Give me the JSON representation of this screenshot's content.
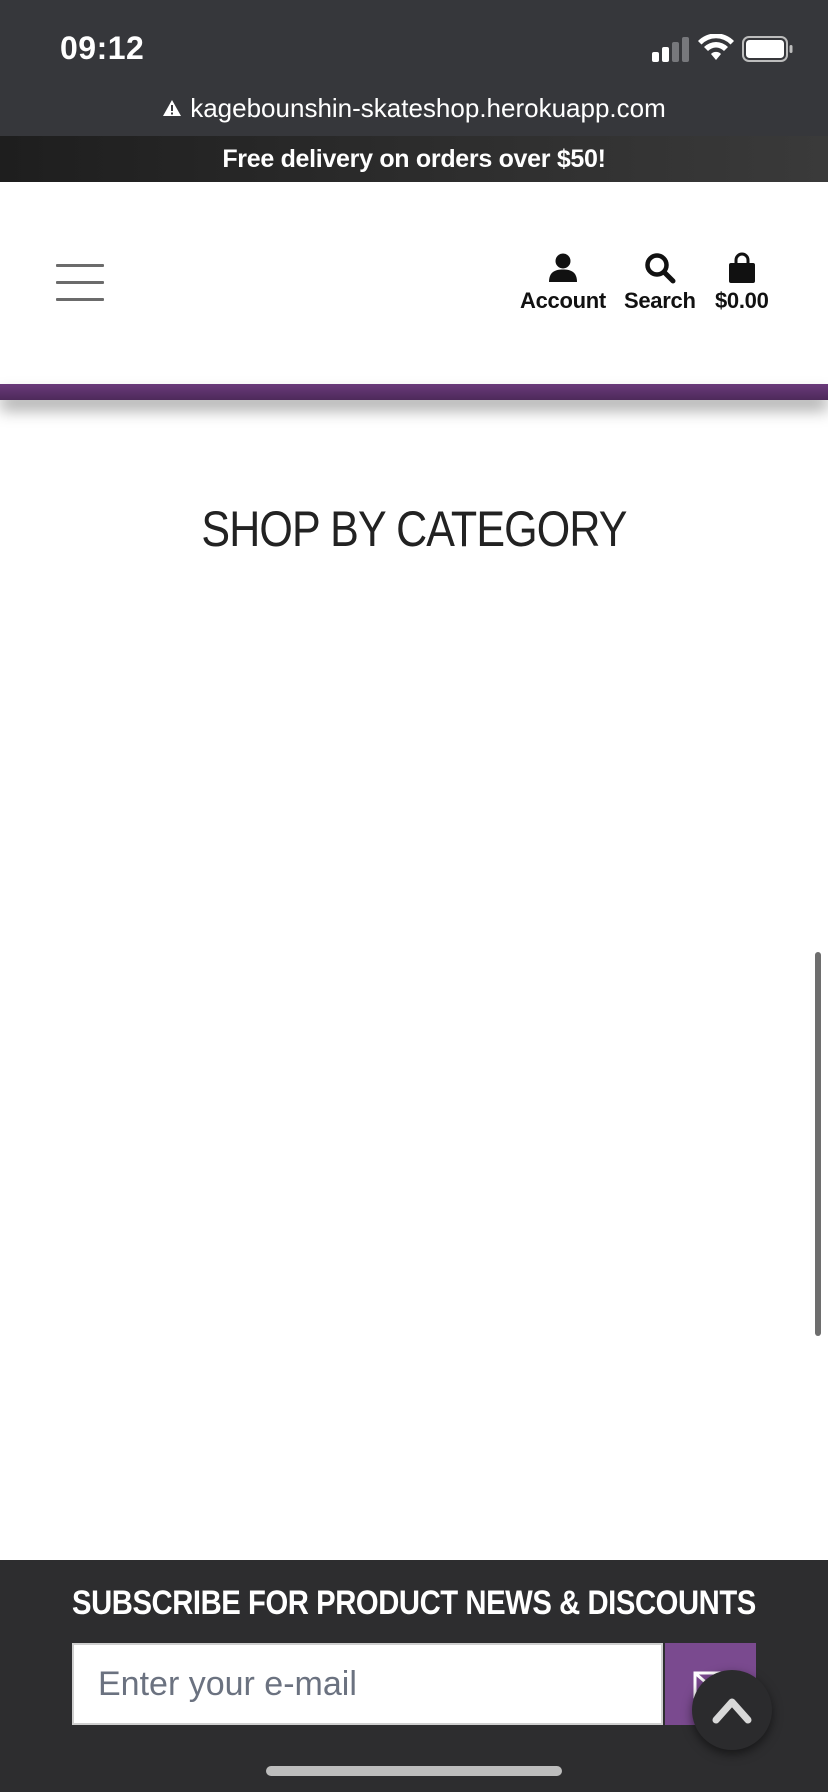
{
  "status_bar": {
    "time": "09:12",
    "url": "kagebounshin-skateshop.herokuapp.com",
    "icons": [
      "warning-icon",
      "signal-icon",
      "wifi-icon",
      "battery-icon"
    ]
  },
  "promo": {
    "text": "Free delivery on orders over $50!"
  },
  "header": {
    "menu_icon": "hamburger-icon",
    "account_label": "Account",
    "search_label": "Search",
    "cart_label": "$0.00",
    "accent_color": "#6a3a7a"
  },
  "main": {
    "section_title": "SHOP BY CATEGORY"
  },
  "subscribe": {
    "title": "SUBSCRIBE FOR PRODUCT NEWS & DISCOUNTS",
    "email_placeholder": "Enter your e-mail",
    "email_value": "",
    "button_icon": "envelope-icon",
    "button_color": "#7a4a8f"
  },
  "back_to_top_icon": "chevron-up-icon"
}
